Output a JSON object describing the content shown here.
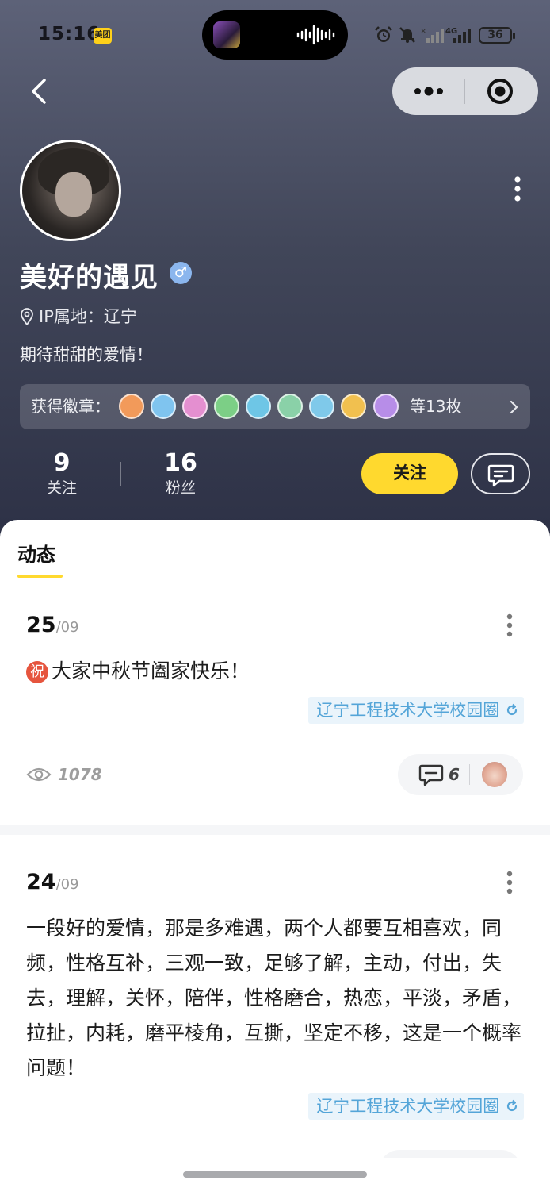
{
  "status_bar": {
    "time": "15:16",
    "app_badge": "美团",
    "battery": "36",
    "network": "4G"
  },
  "header": {
    "more_icon": "more-dots-icon",
    "close_icon": "target-icon"
  },
  "profile": {
    "name": "美好的遇见",
    "gender_symbol": "♂",
    "ip_location": "IP属地：辽宁",
    "bio": "期待甜甜的爱情！",
    "badges_label": "获得徽章：",
    "badges_count": "等13枚",
    "badge_colors": [
      "#f29a5a",
      "#7fc4ef",
      "#e48fd0",
      "#7ccf86",
      "#6ec6e6",
      "#8ad1a8",
      "#7fc9ea",
      "#f1c04f",
      "#b78de8"
    ],
    "following_count": "9",
    "following_label": "关注",
    "followers_count": "16",
    "followers_label": "粉丝",
    "follow_button": "关注"
  },
  "tabs": {
    "active": "动态"
  },
  "posts": [
    {
      "day": "25",
      "month": "/09",
      "zhu": "祝",
      "text": "大家中秋节阖家快乐！",
      "circle": "辽宁工程技术大学校园圈",
      "views": "1078",
      "comments": "6"
    },
    {
      "day": "24",
      "month": "/09",
      "text": "一段好的爱情，那是多难遇，两个人都要互相喜欢，同频，性格互补，三观一致，足够了解，主动，付出，失去，理解，关怀，陪伴，性格磨合，热恋，平淡，矛盾，拉扯，内耗，磨平棱角，互撕，坚定不移，这是一个概率问题！",
      "circle": "辽宁工程技术大学校园圈"
    }
  ]
}
